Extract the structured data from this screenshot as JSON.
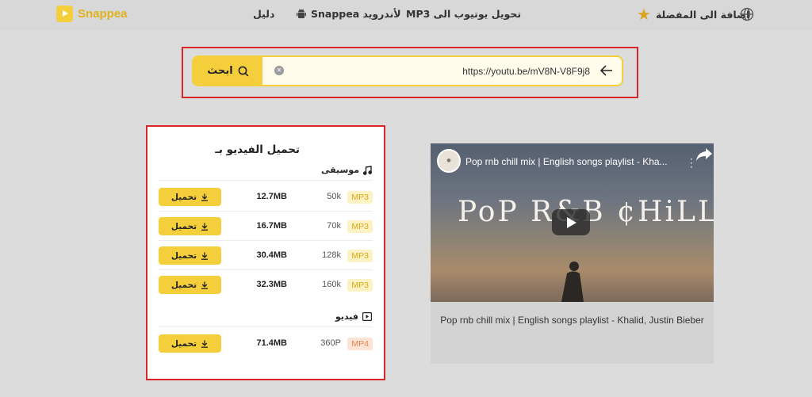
{
  "header": {
    "logo_text": "Snappea",
    "nav": {
      "guide": "دليل",
      "android": "Snappea لأندرويد",
      "mp3": "MP3 تحويل يوتيوب الى",
      "favorites": "اضافة الى المفضلة"
    },
    "icons": [
      "snappea-logo-icon",
      "android-icon",
      "star-icon",
      "globe-icon"
    ]
  },
  "search": {
    "button_label": "ابحث",
    "value": "https://youtu.be/mV8N-V8F9j8",
    "icons": [
      "search-icon",
      "clear-icon",
      "arrow-left-icon"
    ]
  },
  "download_panel": {
    "title": "تحميل الفيديو بـ",
    "music_label": "موسيقى",
    "video_label": "فيديو",
    "button_label": "تحميل",
    "music_rows": [
      {
        "format": "MP3",
        "quality": "50k",
        "size": "12.7MB"
      },
      {
        "format": "MP3",
        "quality": "70k",
        "size": "16.7MB"
      },
      {
        "format": "MP3",
        "quality": "128k",
        "size": "30.4MB"
      },
      {
        "format": "MP3",
        "quality": "160k",
        "size": "32.3MB"
      }
    ],
    "video_rows": [
      {
        "format": "MP4",
        "quality": "360P",
        "size": "71.4MB"
      }
    ]
  },
  "video": {
    "player_title": "Pop rnb chill mix | English songs playlist - Kha...",
    "overlay_text": "PoP R&B ¢HiLL MiX",
    "caption": "Pop rnb chill mix | English songs playlist - Khalid, Justin Bieber"
  },
  "colors": {
    "accent": "#f5cf3b",
    "highlight_border": "#d9262b",
    "mp3_badge": "#fdf2c4",
    "mp4_badge": "#fde3d3"
  }
}
